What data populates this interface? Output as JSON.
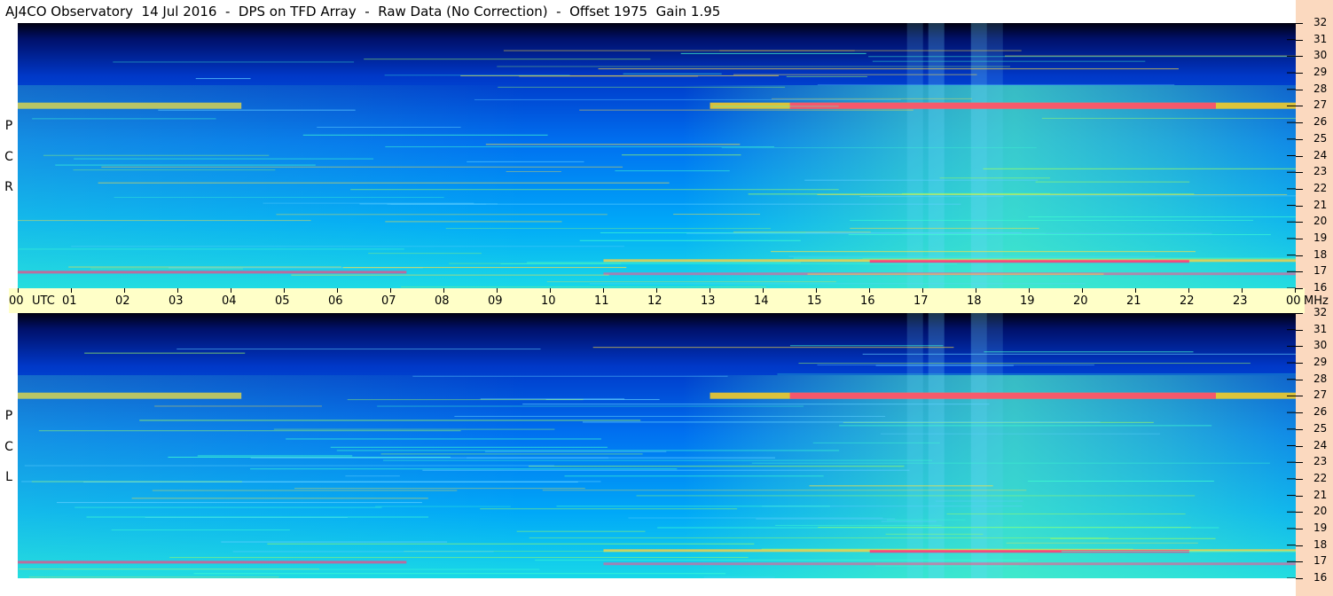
{
  "title": "AJ4CO Observatory  14 Jul 2016  -  DPS on TFD Array  -  Raw Data (No Correction)  -  Offset 1975  Gain 1.95",
  "chart_data": [
    {
      "type": "heatmap",
      "name": "RCP",
      "pol_label": [
        "R",
        "C",
        "P"
      ],
      "x_unit": "UTC",
      "y_unit": "MHz",
      "x_ticks": [
        "00",
        "01",
        "02",
        "03",
        "04",
        "05",
        "06",
        "07",
        "08",
        "09",
        "10",
        "11",
        "12",
        "13",
        "14",
        "15",
        "16",
        "17",
        "18",
        "19",
        "20",
        "21",
        "22",
        "23",
        "00"
      ],
      "y_ticks": [
        32,
        31,
        30,
        29,
        28,
        27,
        26,
        25,
        24,
        23,
        22,
        21,
        20,
        19,
        18,
        17,
        16
      ],
      "xlim": [
        0,
        24
      ],
      "ylim": [
        16,
        32
      ],
      "colormap": [
        "#000018",
        "#001a80",
        "#0040d8",
        "#00a0ff",
        "#20e0e0",
        "#a0ff40",
        "#ffe000",
        "#ff2080",
        "#ffffff"
      ]
    },
    {
      "type": "heatmap",
      "name": "LCP",
      "pol_label": [
        "L",
        "C",
        "P"
      ],
      "x_unit": "UTC",
      "y_unit": "MHz",
      "x_ticks": [
        "00",
        "01",
        "02",
        "03",
        "04",
        "05",
        "06",
        "07",
        "08",
        "09",
        "10",
        "11",
        "12",
        "13",
        "14",
        "15",
        "16",
        "17",
        "18",
        "19",
        "20",
        "21",
        "22",
        "23",
        "00"
      ],
      "y_ticks": [
        32,
        31,
        30,
        29,
        28,
        27,
        26,
        25,
        24,
        23,
        22,
        21,
        20,
        19,
        18,
        17,
        16
      ],
      "xlim": [
        0,
        24
      ],
      "ylim": [
        16,
        32
      ],
      "colormap": [
        "#000018",
        "#001a80",
        "#0040d8",
        "#00a0ff",
        "#20e0e0",
        "#a0ff40",
        "#ffe000",
        "#ff2080",
        "#ffffff"
      ]
    }
  ],
  "time_axis": {
    "labels": [
      "00",
      "01",
      "02",
      "03",
      "04",
      "05",
      "06",
      "07",
      "08",
      "09",
      "10",
      "11",
      "12",
      "13",
      "14",
      "15",
      "16",
      "17",
      "18",
      "19",
      "20",
      "21",
      "22",
      "23",
      "00"
    ],
    "utc_label": "UTC",
    "mhz_label": "MHz"
  }
}
